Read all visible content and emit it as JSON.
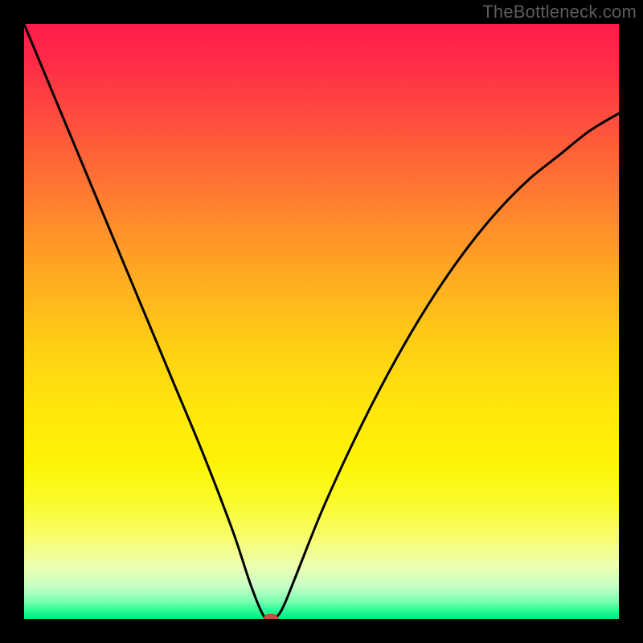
{
  "watermark": "TheBottleneck.com",
  "chart_data": {
    "type": "line",
    "title": "",
    "xlabel": "",
    "ylabel": "",
    "xlim": [
      0,
      100
    ],
    "ylim": [
      0,
      100
    ],
    "grid": false,
    "legend": false,
    "series": [
      {
        "name": "bottleneck-curve",
        "x": [
          0,
          5,
          10,
          15,
          20,
          25,
          30,
          35,
          38,
          40,
          41,
          42,
          43,
          44,
          46,
          50,
          55,
          60,
          65,
          70,
          75,
          80,
          85,
          90,
          95,
          100
        ],
        "values": [
          100,
          88,
          76,
          64,
          52,
          40,
          28,
          15,
          6,
          1,
          0,
          0,
          1,
          3,
          8,
          18,
          29,
          39,
          48,
          56,
          63,
          69,
          74,
          78,
          82,
          85
        ]
      }
    ],
    "marker": {
      "x": 41.5,
      "y": 0
    },
    "background_gradient": {
      "orientation": "vertical",
      "stops": [
        {
          "pos": 0.0,
          "color": "#ff1b4a"
        },
        {
          "pos": 0.35,
          "color": "#ff8e2b"
        },
        {
          "pos": 0.66,
          "color": "#ffe90a"
        },
        {
          "pos": 0.92,
          "color": "#edffae"
        },
        {
          "pos": 1.0,
          "color": "#00e884"
        }
      ]
    }
  }
}
